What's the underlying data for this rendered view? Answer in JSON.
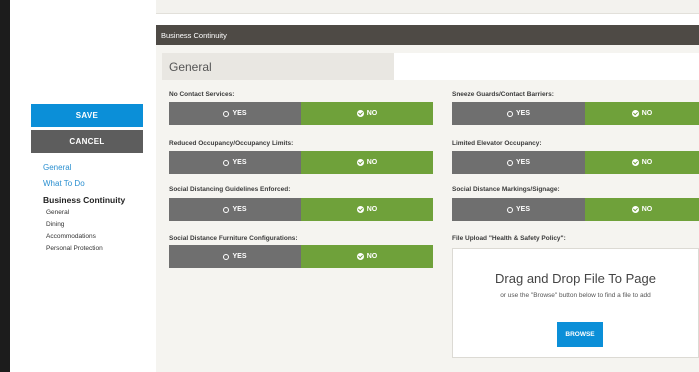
{
  "buttons": {
    "save": "SAVE",
    "cancel": "CANCEL"
  },
  "nav": {
    "items": [
      "General",
      "What To Do"
    ],
    "current": "Business Continuity",
    "subitems": [
      "General",
      "Dining",
      "Accommodations",
      "Personal Protection"
    ]
  },
  "section": {
    "title": "Business Continuity",
    "tab": "General"
  },
  "options": {
    "yes": "YES",
    "no": "NO"
  },
  "questions": [
    {
      "label": "No Contact Services:",
      "selected": "NO"
    },
    {
      "label": "Sneeze Guards/Contact Barriers:",
      "selected": "NO"
    },
    {
      "label": "Reduced Occupancy/Occupancy Limits:",
      "selected": "NO"
    },
    {
      "label": "Limited Elevator Occupancy:",
      "selected": "NO"
    },
    {
      "label": "Social Distancing Guidelines Enforced:",
      "selected": "NO"
    },
    {
      "label": "Social Distance Markings/Signage:",
      "selected": "NO"
    },
    {
      "label": "Social Distance Furniture Configurations:",
      "selected": "NO"
    }
  ],
  "upload": {
    "label": "File Upload \"Health & Safety Policy\":",
    "title": "Drag and Drop File To Page",
    "subtitle": "or use the \"Browse\" button below to find a file to add",
    "button": "BROWSE"
  },
  "colors": {
    "primary": "#0b8fd8",
    "selected": "#6fa13a",
    "unselected": "#6f6f6f",
    "header": "#4e4a45"
  }
}
